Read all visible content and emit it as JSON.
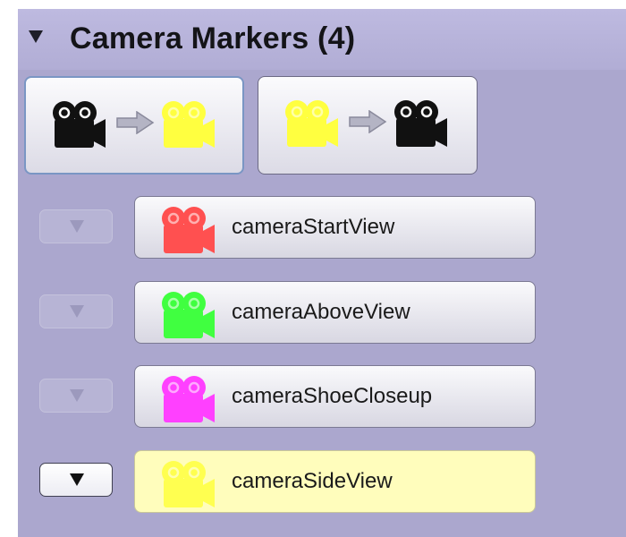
{
  "header": {
    "title": "Camera Markers (4)"
  },
  "swap_buttons": [
    {
      "name": "swap-active-to-view",
      "from_color": "#111111",
      "to_color": "#ffff40"
    },
    {
      "name": "swap-view-to-active",
      "from_color": "#ffff40",
      "to_color": "#111111"
    }
  ],
  "colors": {
    "panel": "#aba7ce",
    "header": "#b8b4db",
    "arrow": "#a8a8b8",
    "active_marker": "#fffdbc"
  },
  "markers": [
    {
      "label": "cameraStartView",
      "color": "#ff5050",
      "active": false
    },
    {
      "label": "cameraAboveView",
      "color": "#40ff40",
      "active": false
    },
    {
      "label": "cameraShoeCloseup",
      "color": "#ff40ff",
      "active": false
    },
    {
      "label": "cameraSideView",
      "color": "#ffff50",
      "active": true
    }
  ],
  "icons": {
    "expand": "triangle-down-icon",
    "camera": "movie-camera-icon",
    "arrow": "right-arrow-icon"
  }
}
